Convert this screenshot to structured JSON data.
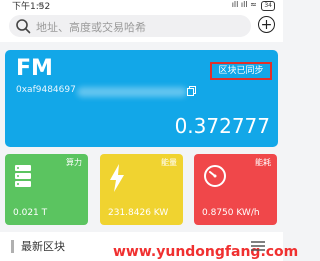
{
  "status_bar": {
    "time": "下午1:52",
    "extra": "⊙",
    "signal": "ıll ıll ≈",
    "battery": "34"
  },
  "search": {
    "placeholder": "地址、高度或交易哈希"
  },
  "card": {
    "title": "FM",
    "address": "0xaf9484697",
    "sync_status": "区块已同步",
    "value": "0.372777"
  },
  "tiles": [
    {
      "label": "算力",
      "value": "0.021 T",
      "color": "#5bc460",
      "icon": "server-icon"
    },
    {
      "label": "能量",
      "value": "231.8426 KW",
      "color": "#f0d330",
      "icon": "lightning-icon"
    },
    {
      "label": "能耗",
      "value": "0.8750 KW/h",
      "color": "#f0474a",
      "icon": "gauge-icon"
    }
  ],
  "section": {
    "title": "最新区块",
    "watermark": "www.yundongfang.com"
  }
}
